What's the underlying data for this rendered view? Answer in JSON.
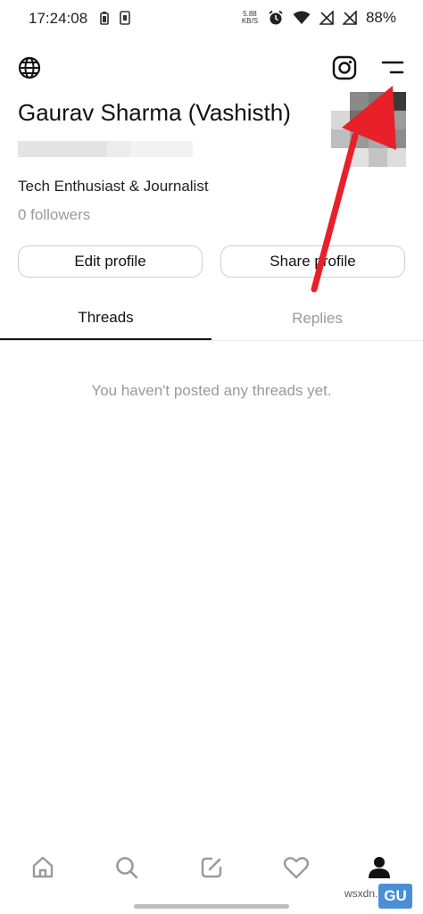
{
  "status_bar": {
    "time": "17:24:08",
    "network_speed_top": "5.88",
    "network_speed_bottom": "KB/S",
    "battery": "88%"
  },
  "header": {
    "globe_icon": "globe-icon",
    "instagram_icon": "instagram-icon",
    "menu_icon": "menu-icon"
  },
  "profile": {
    "name": "Gaurav Sharma (Vashisth)",
    "bio": "Tech Enthusiast & Journalist",
    "followers": "0 followers"
  },
  "buttons": {
    "edit_profile": "Edit profile",
    "share_profile": "Share profile"
  },
  "tabs": {
    "threads": "Threads",
    "replies": "Replies"
  },
  "feed": {
    "empty_message": "You haven't posted any threads yet."
  },
  "nav": {
    "home": "home-icon",
    "search": "search-icon",
    "compose": "compose-icon",
    "activity": "heart-icon",
    "profile": "profile-icon"
  },
  "colors": {
    "annotation_arrow": "#e8202a",
    "muted_text": "#9a9a9a"
  },
  "watermark": {
    "text": "wsxdn.com",
    "logo_text": "GU"
  }
}
